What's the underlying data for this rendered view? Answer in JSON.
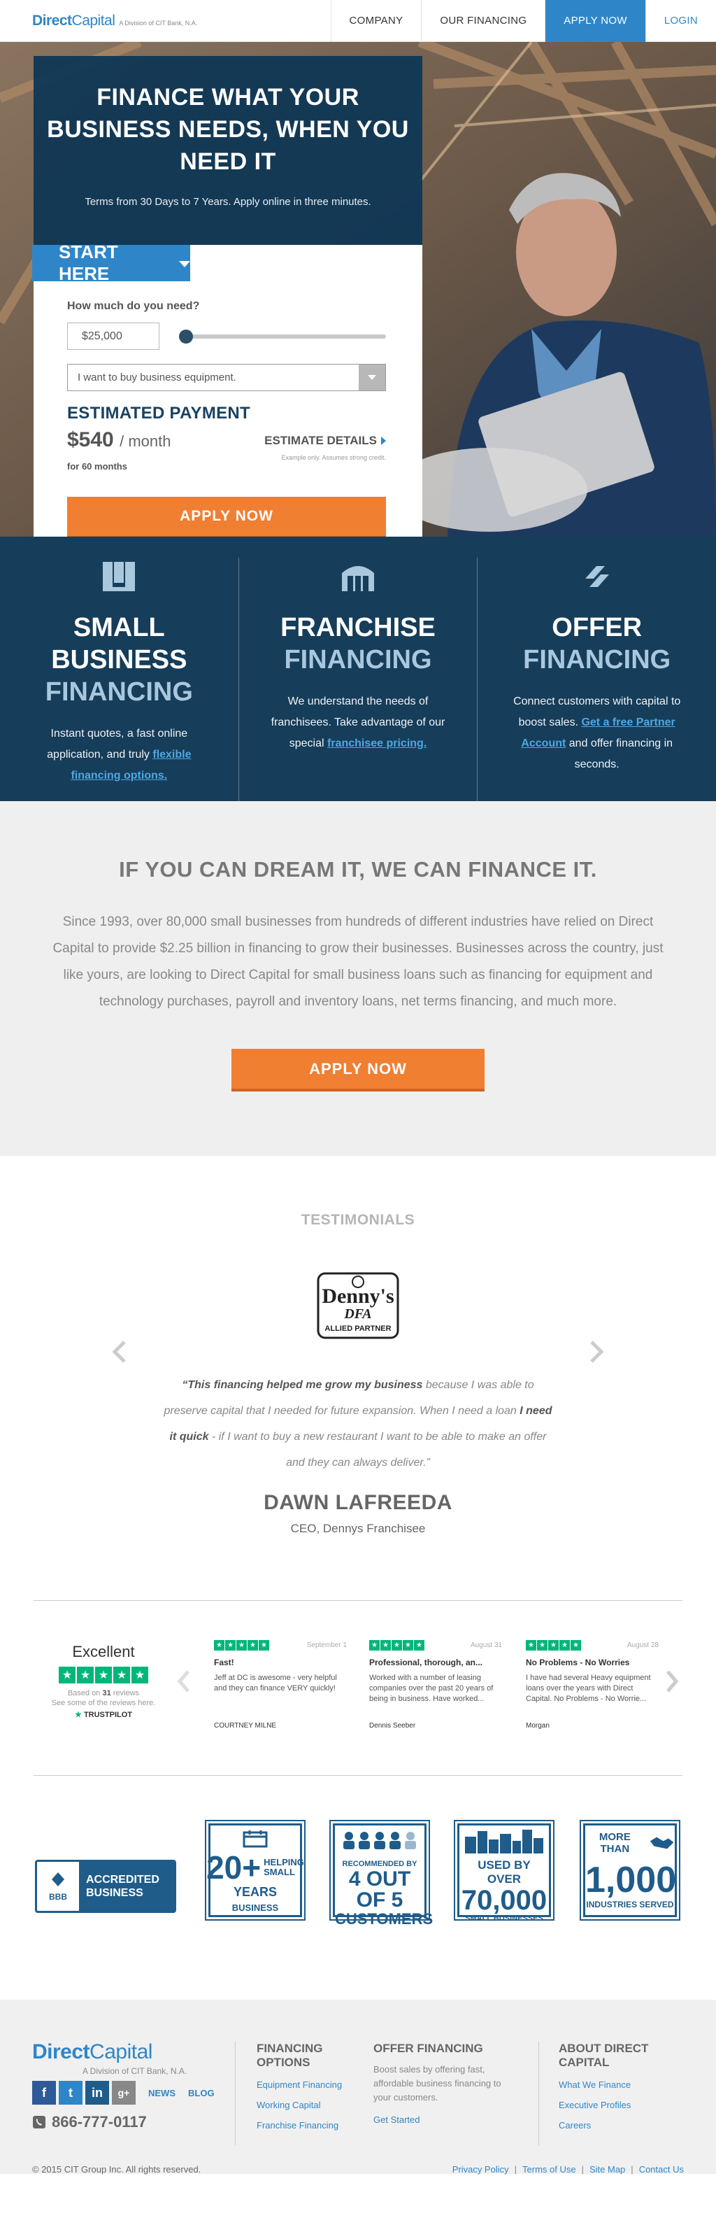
{
  "header": {
    "brand_a": "Direct",
    "brand_b": "Capital",
    "tagline": "A Division of CIT Bank, N.A.",
    "nav": [
      "COMPANY",
      "OUR FINANCING",
      "APPLY NOW",
      "LOGIN"
    ]
  },
  "hero": {
    "headline": "FINANCE WHAT YOUR BUSINESS NEEDS, WHEN YOU NEED IT",
    "subline": "Terms from 30 Days to 7 Years. Apply online in three minutes.",
    "start_here": "START HERE",
    "question": "How much do you need?",
    "amount": "$25,000",
    "purpose": "I want to buy business equipment.",
    "estimate_title": "ESTIMATED PAYMENT",
    "payment": "$540",
    "per": "/ month",
    "term": "for 60 months",
    "estimate_details": "ESTIMATE DETAILS",
    "note": "Example only. Assumes strong credit.",
    "apply": "APPLY NOW"
  },
  "features": [
    {
      "title1": "SMALL BUSINESS",
      "title2": "FINANCING",
      "text": "Instant quotes, a fast online application, and truly ",
      "link": "flexible financing options.",
      "text_after": "",
      "icon": "stacked-books-icon"
    },
    {
      "title1": "FRANCHISE",
      "title2": "FINANCING",
      "text": "We understand the needs of franchisees. Take advantage of our special ",
      "link": "franchisee pricing.",
      "text_after": "",
      "icon": "storefront-icon"
    },
    {
      "title1": "OFFER",
      "title2": "FINANCING",
      "text": "Connect customers with capital to boost sales. ",
      "link": "Get a free Partner Account",
      "text_after": " and offer financing in seconds.",
      "icon": "partner-link-icon"
    }
  ],
  "dream": {
    "title": "IF YOU CAN DREAM IT, WE CAN FINANCE IT.",
    "body": "Since 1993, over 80,000 small businesses from hundreds of different industries have relied on Direct Capital to provide $2.25 billion in financing to grow their businesses. Businesses across the country, just like yours, are looking to Direct Capital for small business loans such as financing for equipment and technology purchases, payroll and inventory loans, net terms financing, and much more.",
    "apply": "APPLY NOW"
  },
  "testimonials": {
    "title": "TESTIMONIALS",
    "logo_line1": "Denny's",
    "logo_line2": "DFA",
    "logo_line3": "ALLIED PARTNER",
    "quote_b1": "“This financing helped me grow my business",
    "quote_t1": " because I was able to preserve capital that I needed for future expansion. When I need a loan ",
    "quote_b2": "I need it quick",
    "quote_t2": " - if I want to buy a new restaurant I want to be able to make an offer and they can always deliver.”",
    "name": "DAWN LAFREEDA",
    "role": "CEO, Dennys Franchisee"
  },
  "trustpilot": {
    "excellent": "Excellent",
    "based_pre": "Based on ",
    "based_count": "31",
    "based_post": " reviews",
    "see": "See some of the reviews here.",
    "logo": "TRUSTPILOT",
    "reviews": [
      {
        "date": "September 1",
        "title": "Fast!",
        "body": "Jeff at DC is awesome - very helpful and they can finance VERY quickly!",
        "author": "COURTNEY MILNE"
      },
      {
        "date": "August 31",
        "title": "Professional, thorough, an...",
        "body": "Worked with a number of leasing companies over the past 20 years of being in business. Have worked...",
        "author": "Dennis Seeber"
      },
      {
        "date": "August 28",
        "title": "No Problems - No Worries",
        "body": "I have had several Heavy equipment loans over the years with Direct Capital. No Problems - No Worrie...",
        "author": "Morgan"
      }
    ]
  },
  "badges": {
    "bbb_seal": "BBB",
    "bbb_text": "ACCREDITED BUSINESS",
    "years_num": "20+",
    "years_side": "HELPING SMALL",
    "years_bottom_a": "YEARS",
    "years_bottom_b": "BUSINESS",
    "cust_l1": "RECOMMENDED BY",
    "cust_l2": "4 OUT OF 5",
    "cust_l3": "CUSTOMERS",
    "biz_l1": "USED BY OVER",
    "biz_l2": "70,000",
    "biz_l3": "SMALL BUSINESSES",
    "ind_l1": "MORE THAN",
    "ind_l2": "1,000",
    "ind_l3": "INDUSTRIES SERVED"
  },
  "footer": {
    "brand_a": "Direct",
    "brand_b": "Capital",
    "tagline": "A Division of CIT Bank, N.A.",
    "news": "NEWS",
    "blog": "BLOG",
    "phone": "866-777-0117",
    "col1_title": "FINANCING OPTIONS",
    "col1_links": [
      "Equipment Financing",
      "Working Capital",
      "Franchise Financing"
    ],
    "col2_title": "OFFER FINANCING",
    "col2_text": "Boost sales by offering fast, affordable business financing to your customers.",
    "col2_link": "Get Started",
    "col3_title": "ABOUT DIRECT CAPITAL",
    "col3_links": [
      "What We Finance",
      "Executive Profiles",
      "Careers"
    ],
    "copyright": "© 2015 CIT Group Inc. All rights reserved.",
    "legal": [
      "Privacy Policy",
      "Terms of Use",
      "Site Map",
      "Contact Us"
    ]
  },
  "colors": {
    "brand_blue": "#2e86c8",
    "navy": "#163d59",
    "orange": "#f07f32",
    "trustpilot_green": "#00b67a"
  }
}
